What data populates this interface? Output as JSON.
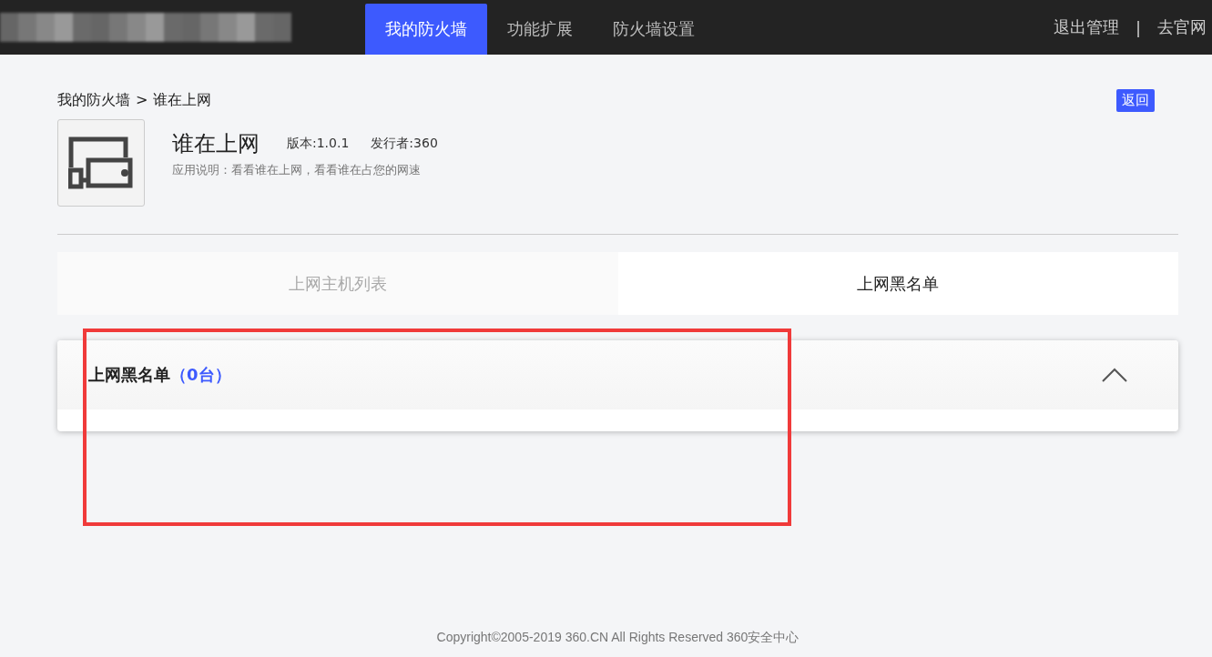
{
  "nav": {
    "tabs": [
      {
        "label": "我的防火墙",
        "selected": true
      },
      {
        "label": "功能扩展",
        "selected": false
      },
      {
        "label": "防火墙设置",
        "selected": false
      }
    ],
    "links": [
      "退出管理",
      "去官网"
    ],
    "separator": "|"
  },
  "breadcrumb": {
    "items": [
      "我的防火墙",
      "谁在上网"
    ],
    "separator": ">"
  },
  "back_button": "返回",
  "app": {
    "name": "谁在上网",
    "version": "版本:1.0.1",
    "publisher": "发行者:360",
    "description": "应用说明：看看谁在上网，看看谁在占您的网速"
  },
  "tabs": [
    {
      "label": "上网主机列表",
      "selected": false
    },
    {
      "label": "上网黑名单",
      "selected": true
    }
  ],
  "panel": {
    "title": "上网黑名单",
    "count": "（0台）",
    "expanded": true
  },
  "footer": "Copyright©2005-2019 360.CN All Rights Reserved 360安全中心"
}
